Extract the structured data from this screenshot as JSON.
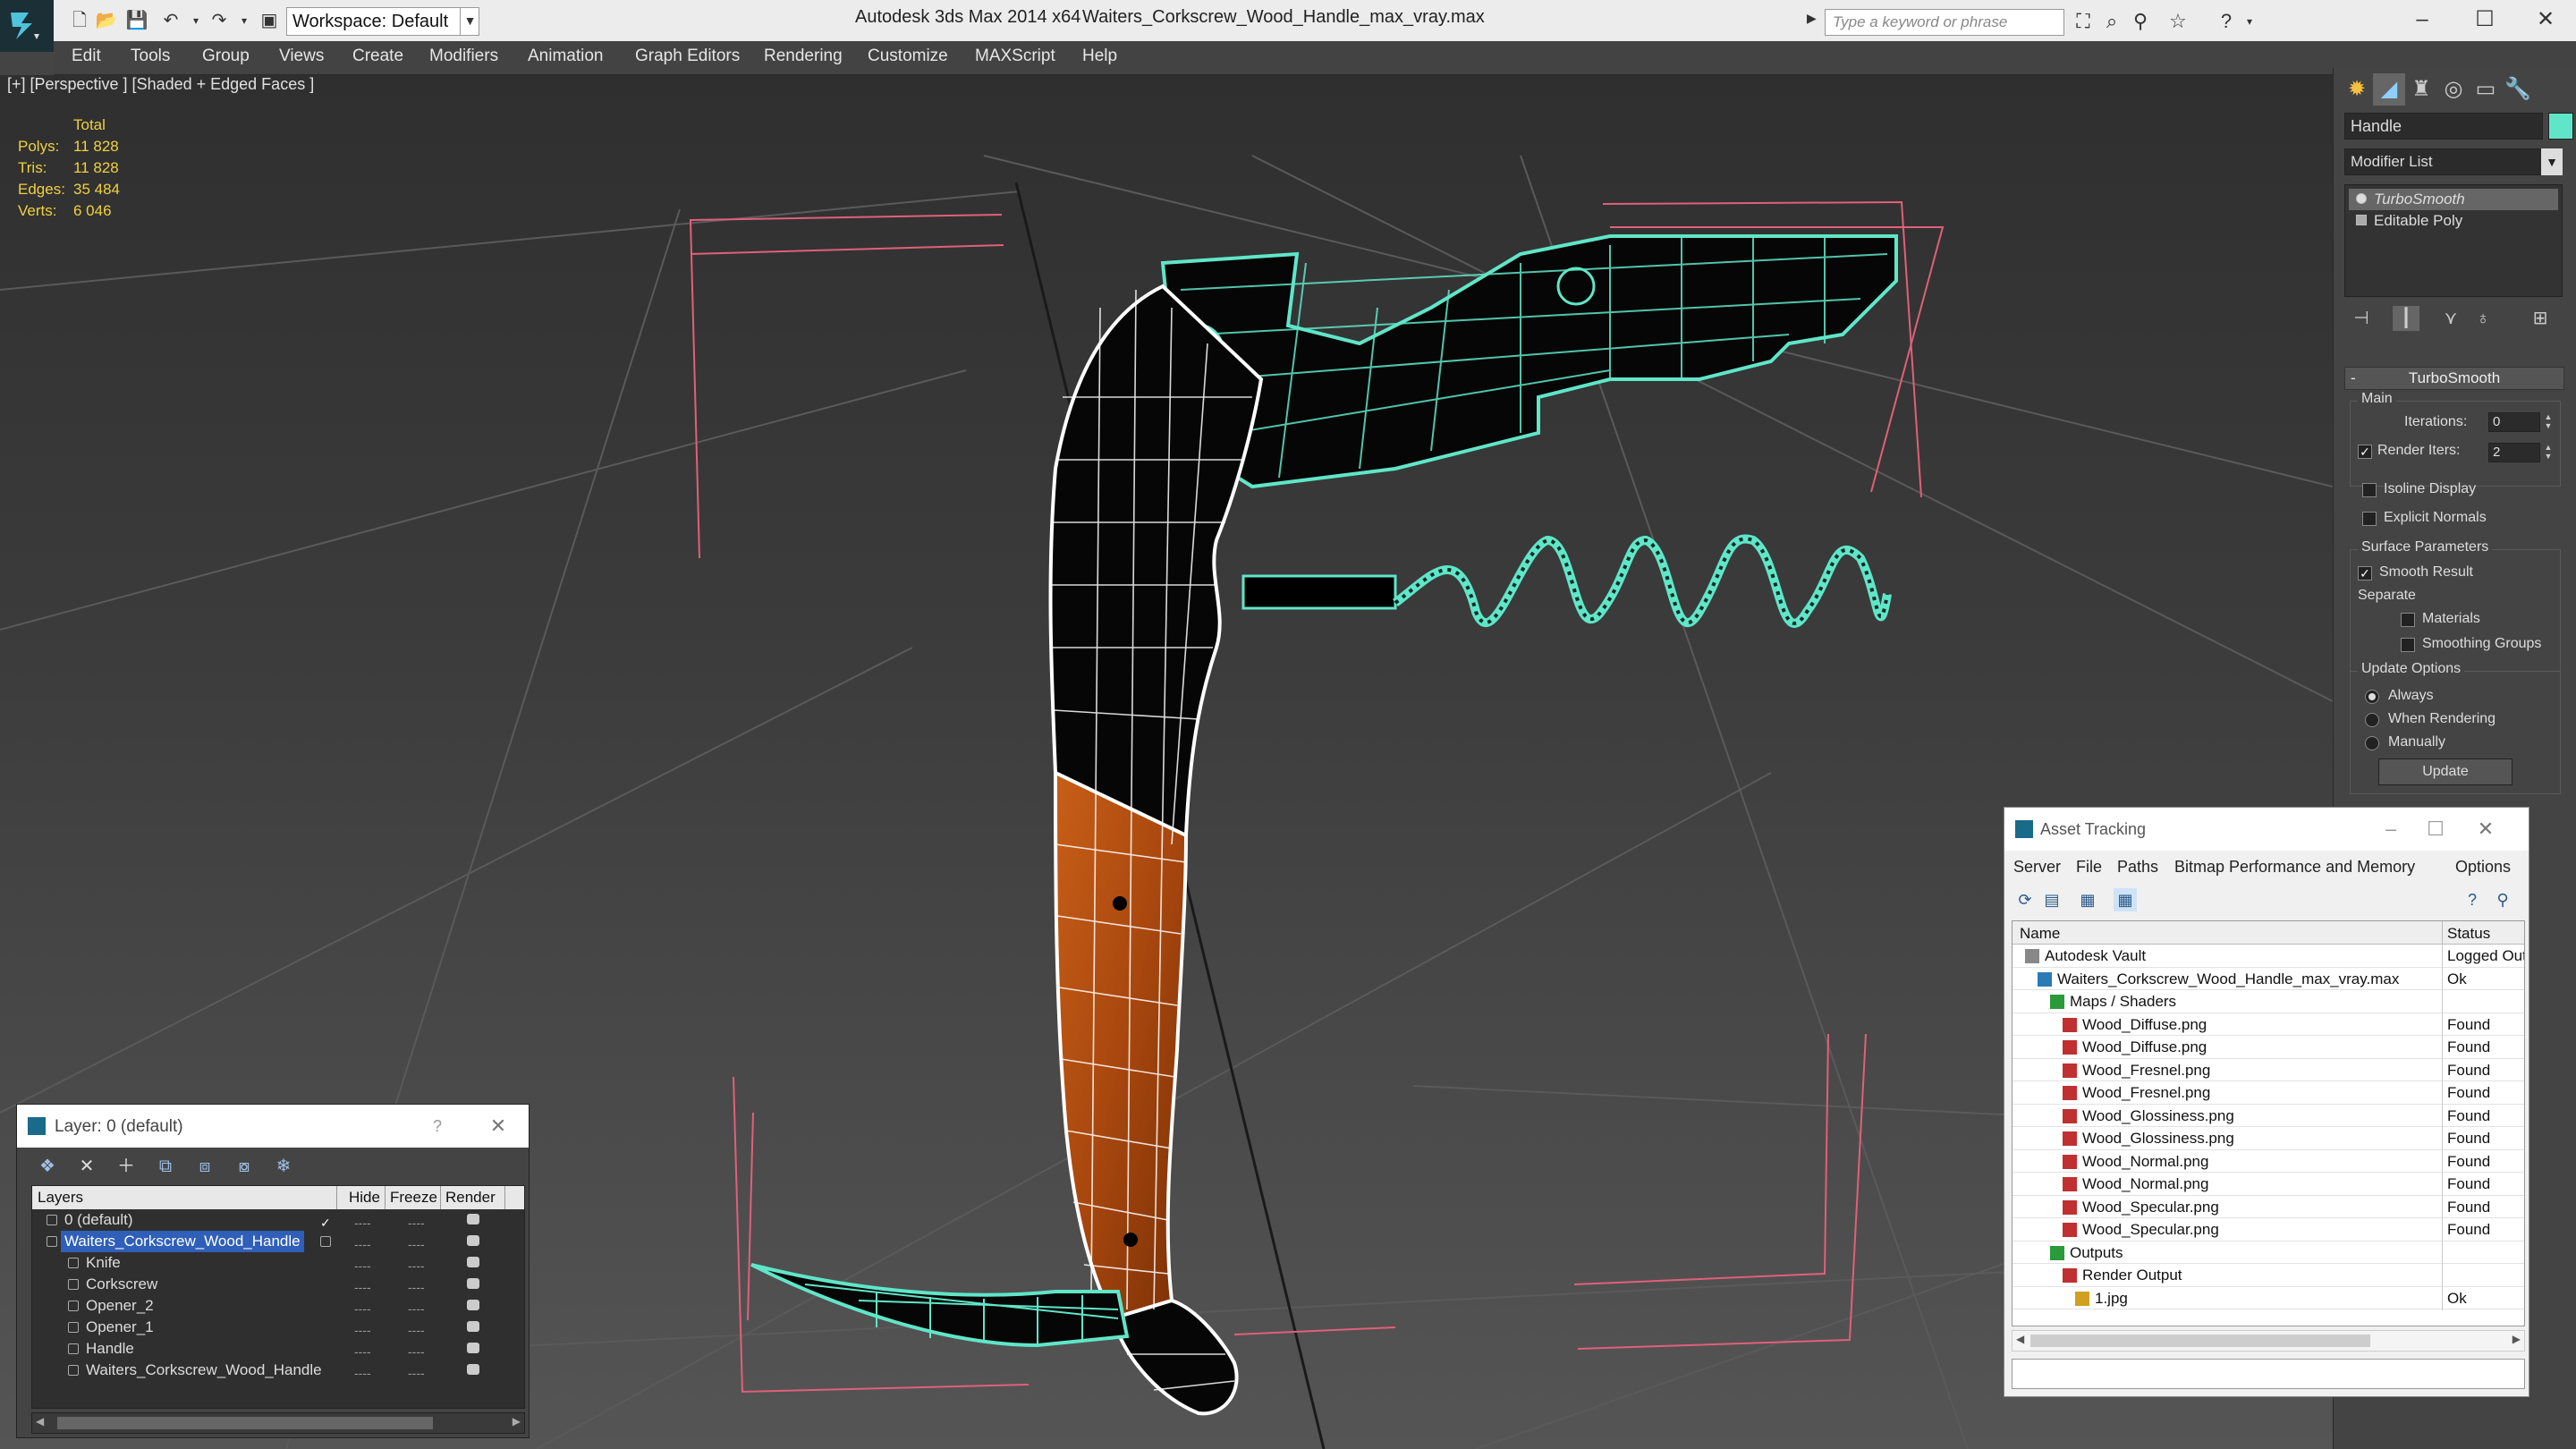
{
  "titlebar": {
    "workspace": "Workspace: Default",
    "app_title": "Autodesk 3ds Max 2014 x64",
    "file_title": "Waiters_Corkscrew_Wood_Handle_max_vray.max",
    "search_placeholder": "Type a keyword or phrase",
    "minimize": "–",
    "maximize": "☐",
    "close": "✕"
  },
  "menubar": {
    "items": [
      "Edit",
      "Tools",
      "Group",
      "Views",
      "Create",
      "Modifiers",
      "Animation",
      "Graph Editors",
      "Rendering",
      "Customize",
      "MAXScript",
      "Help"
    ]
  },
  "viewport": {
    "label": "[+] [Perspective ] [Shaded + Edged Faces ]",
    "stats": {
      "header": "Total",
      "rows": [
        {
          "label": "Polys:",
          "value": "11 828"
        },
        {
          "label": "Tris:",
          "value": "11 828"
        },
        {
          "label": "Edges:",
          "value": "35 484"
        },
        {
          "label": "Verts:",
          "value": "6 046"
        }
      ]
    }
  },
  "command_panel": {
    "object_name": "Handle",
    "object_color": "#5fe6c8",
    "modifier_list": "Modifier List",
    "stack": [
      "TurboSmooth",
      "Editable Poly"
    ],
    "turbosmooth": {
      "title": "TurboSmooth",
      "collapse": "-",
      "main": "Main",
      "iterations_label": "Iterations:",
      "iterations_value": "0",
      "render_iters_label": "Render Iters:",
      "render_iters_value": "2",
      "isoline": "Isoline Display",
      "explicit_normals": "Explicit Normals",
      "surface_params": "Surface Parameters",
      "smooth_result": "Smooth Result",
      "separate": "Separate",
      "materials": "Materials",
      "smoothing_groups": "Smoothing Groups",
      "update_options": "Update Options",
      "always": "Always",
      "when_rendering": "When Rendering",
      "manually": "Manually",
      "update": "Update"
    }
  },
  "asset_tracking": {
    "title": "Asset Tracking",
    "menus": [
      "Server",
      "File",
      "Paths",
      "Bitmap Performance and Memory",
      "Options"
    ],
    "col_name": "Name",
    "col_status": "Status",
    "rows": [
      {
        "name": "Autodesk Vault",
        "status": "Logged Out",
        "indent": 0
      },
      {
        "name": "Waiters_Corkscrew_Wood_Handle_max_vray.max",
        "status": "Ok",
        "indent": 1
      },
      {
        "name": "Maps / Shaders",
        "status": "",
        "indent": 2
      },
      {
        "name": "Wood_Diffuse.png",
        "status": "Found",
        "indent": 3
      },
      {
        "name": "Wood_Diffuse.png",
        "status": "Found",
        "indent": 3
      },
      {
        "name": "Wood_Fresnel.png",
        "status": "Found",
        "indent": 3
      },
      {
        "name": "Wood_Fresnel.png",
        "status": "Found",
        "indent": 3
      },
      {
        "name": "Wood_Glossiness.png",
        "status": "Found",
        "indent": 3
      },
      {
        "name": "Wood_Glossiness.png",
        "status": "Found",
        "indent": 3
      },
      {
        "name": "Wood_Normal.png",
        "status": "Found",
        "indent": 3
      },
      {
        "name": "Wood_Normal.png",
        "status": "Found",
        "indent": 3
      },
      {
        "name": "Wood_Specular.png",
        "status": "Found",
        "indent": 3
      },
      {
        "name": "Wood_Specular.png",
        "status": "Found",
        "indent": 3
      },
      {
        "name": "Outputs",
        "status": "",
        "indent": 2
      },
      {
        "name": "Render Output",
        "status": "",
        "indent": 3
      },
      {
        "name": "1.jpg",
        "status": "Ok",
        "indent": 4
      }
    ]
  },
  "layer_window": {
    "title": "Layer: 0 (default)",
    "help": "?",
    "close": "✕",
    "headers": {
      "layers": "Layers",
      "hide": "Hide",
      "freeze": "Freeze",
      "render": "Render"
    },
    "rows": [
      {
        "name": "0 (default)",
        "indent": 1,
        "selected": false
      },
      {
        "name": "Waiters_Corkscrew_Wood_Handle",
        "indent": 1,
        "selected": true
      },
      {
        "name": "Knife",
        "indent": 2,
        "selected": false
      },
      {
        "name": "Corkscrew",
        "indent": 2,
        "selected": false
      },
      {
        "name": "Opener_2",
        "indent": 2,
        "selected": false
      },
      {
        "name": "Opener_1",
        "indent": 2,
        "selected": false
      },
      {
        "name": "Handle",
        "indent": 2,
        "selected": false
      },
      {
        "name": "Waiters_Corkscrew_Wood_Handle",
        "indent": 2,
        "selected": false
      }
    ],
    "dash": "----"
  }
}
